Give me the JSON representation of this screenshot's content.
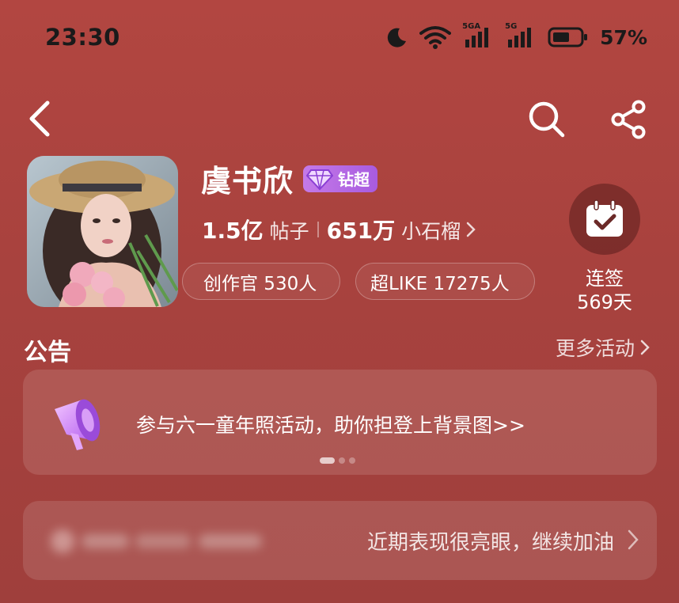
{
  "status_bar": {
    "time": "23:30",
    "battery_percent": "57%",
    "signal_1_label": "5GA",
    "signal_2_label": "5G",
    "icons": [
      "moon-icon",
      "wifi-icon",
      "signal-5ga-icon",
      "signal-5g-icon",
      "battery-icon"
    ]
  },
  "nav": {
    "icons": [
      "back-icon",
      "search-icon",
      "share-icon"
    ]
  },
  "profile": {
    "name": "虞书欣",
    "badge_label": "钻超",
    "posts_count": "1.5亿",
    "posts_unit": "帖子",
    "followers_count": "651万",
    "followers_unit": "小石榴",
    "creator_pill": "创作官 530人",
    "superlike_pill": "超LIKE 17275人",
    "checkin_label": "连签",
    "checkin_days": "569天"
  },
  "announcement": {
    "section_title": "公告",
    "more_label": "更多活动",
    "text": "参与六一童年照活动，助你担登上背景图>>",
    "carousel_pages": 3,
    "carousel_active": 1
  },
  "performance": {
    "text": "近期表现很亮眼，继续加油"
  },
  "colors": {
    "background": "#a8423e",
    "badge": "#b86ae4",
    "checkin_icon_bg": "#6b2a28"
  }
}
